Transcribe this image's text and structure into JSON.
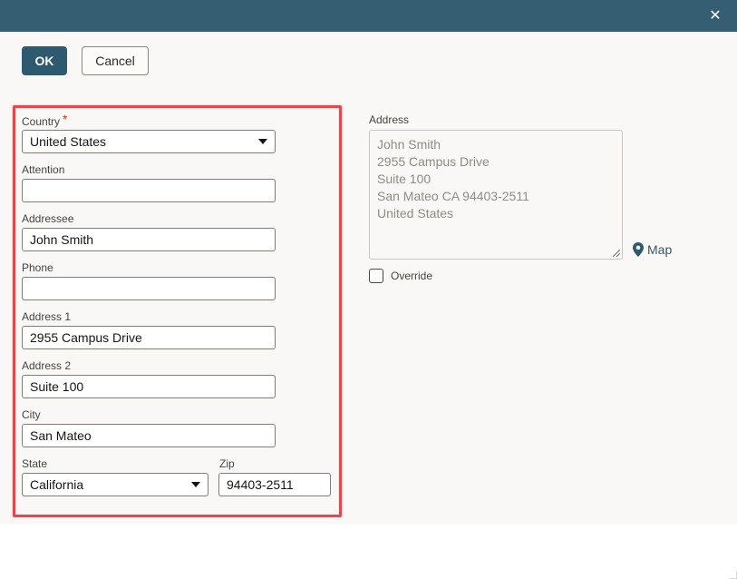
{
  "dialog": {
    "close_symbol": "✕"
  },
  "toolbar": {
    "ok_label": "OK",
    "cancel_label": "Cancel"
  },
  "form": {
    "country": {
      "label": "Country",
      "required_mark": "*",
      "value": "United States"
    },
    "attention": {
      "label": "Attention",
      "value": ""
    },
    "addressee": {
      "label": "Addressee",
      "value": "John Smith"
    },
    "phone": {
      "label": "Phone",
      "value": ""
    },
    "address1": {
      "label": "Address 1",
      "value": "2955 Campus Drive"
    },
    "address2": {
      "label": "Address 2",
      "value": "Suite 100"
    },
    "city": {
      "label": "City",
      "value": "San Mateo"
    },
    "state": {
      "label": "State",
      "value": "California"
    },
    "zip": {
      "label": "Zip",
      "value": "94403-2511"
    }
  },
  "address_preview": {
    "label": "Address",
    "lines": [
      "John Smith",
      "2955 Campus Drive",
      "Suite 100",
      "San Mateo CA 94403-2511",
      "United States"
    ],
    "map_label": "Map",
    "override_label": "Override"
  },
  "colors": {
    "titlebar": "#355e73",
    "primary_button": "#2d5a6f",
    "highlight": "#e4484b",
    "panel": "#f9f8f6"
  }
}
